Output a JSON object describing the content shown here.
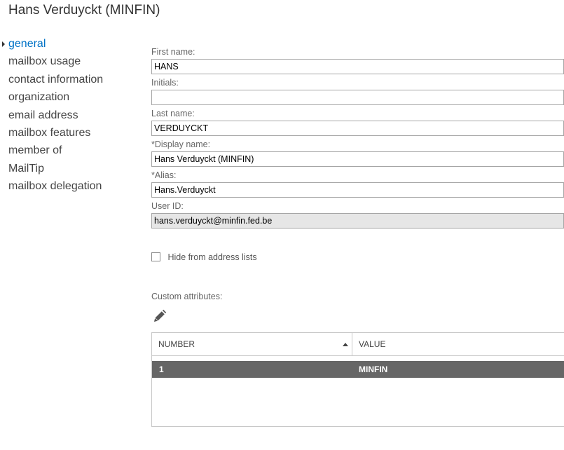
{
  "page": {
    "title": "Hans Verduyckt (MINFIN)"
  },
  "nav": {
    "items": [
      {
        "label": "general",
        "active": true
      },
      {
        "label": "mailbox usage"
      },
      {
        "label": "contact information"
      },
      {
        "label": "organization"
      },
      {
        "label": "email address"
      },
      {
        "label": "mailbox features"
      },
      {
        "label": "member of"
      },
      {
        "label": "MailTip"
      },
      {
        "label": "mailbox delegation"
      }
    ]
  },
  "form": {
    "first_name": {
      "label": "First name:",
      "value": "HANS"
    },
    "initials": {
      "label": "Initials:",
      "value": ""
    },
    "last_name": {
      "label": "Last name:",
      "value": "VERDUYCKT"
    },
    "display_name": {
      "label": "*Display name:",
      "value": "Hans Verduyckt (MINFIN)"
    },
    "alias": {
      "label": "*Alias:",
      "value": "Hans.Verduyckt"
    },
    "user_id": {
      "label": "User ID:",
      "value": "hans.verduyckt@minfin.fed.be"
    },
    "hide_from_lists": {
      "label": "Hide from address lists",
      "checked": false
    }
  },
  "custom_attributes": {
    "label": "Custom attributes:",
    "edit_icon": "pencil-icon",
    "columns": {
      "number": "NUMBER",
      "value": "VALUE"
    },
    "sort": "ascending",
    "rows": [
      {
        "number": "1",
        "value": "MINFIN",
        "selected": true
      }
    ]
  },
  "colors": {
    "accent": "#0072c6",
    "selected_row_bg": "#666666",
    "readonly_bg": "#e6e6e6"
  }
}
